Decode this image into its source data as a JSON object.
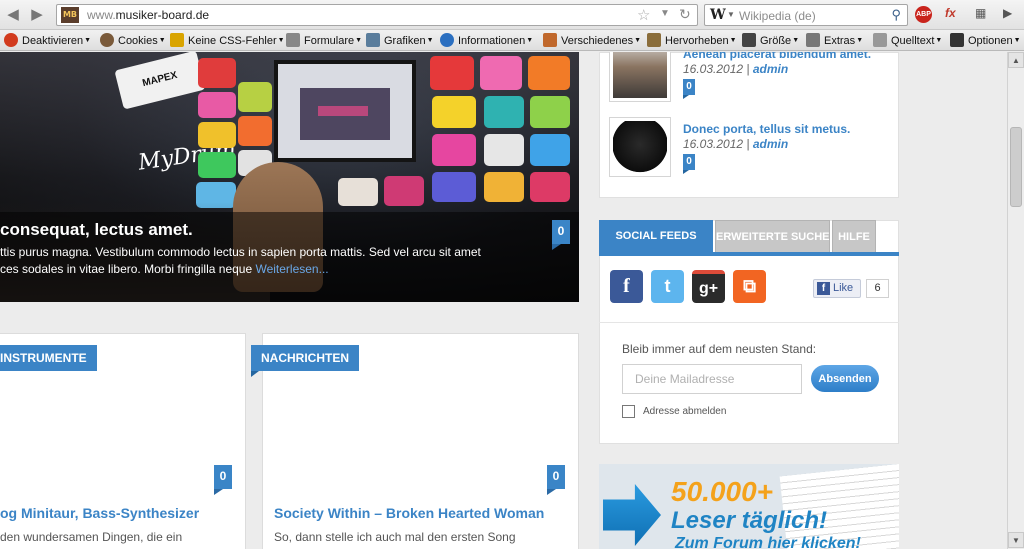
{
  "browser": {
    "url_prefix": "www.",
    "url_domain": "musiker-board.de",
    "site_icon_text": "MB",
    "search_placeholder": "Wikipedia (de)",
    "abp_label": "ABP"
  },
  "devtoolbar": {
    "items": [
      {
        "label": "Deaktivieren",
        "icon": "disable-icon",
        "color": "#d23b1e"
      },
      {
        "label": "Cookies",
        "icon": "cookies-icon",
        "color": "#7a5a3a"
      },
      {
        "label": "Keine CSS-Fehler",
        "icon": "css-pencil-icon",
        "color": "#d9a400"
      },
      {
        "label": "Formulare",
        "icon": "forms-icon",
        "color": "#555555"
      },
      {
        "label": "Grafiken",
        "icon": "images-icon",
        "color": "#5a7d9c"
      },
      {
        "label": "Informationen",
        "icon": "info-icon",
        "color": "#2b6fc0"
      },
      {
        "label": "Verschiedenes",
        "icon": "misc-icon",
        "color": "#c0682c"
      },
      {
        "label": "Hervorheben",
        "icon": "highlight-icon",
        "color": "#555555"
      },
      {
        "label": "Größe",
        "icon": "resize-icon",
        "color": "#444444"
      },
      {
        "label": "Extras",
        "icon": "tools-icon",
        "color": "#555555"
      },
      {
        "label": "Quelltext",
        "icon": "source-icon",
        "color": "#666666"
      },
      {
        "label": "Optionen",
        "icon": "options-icon",
        "color": "#333333"
      }
    ]
  },
  "slider": {
    "brand_sign": "MAPEX",
    "drum_sign": "MyDrum",
    "title": "consequat, lectus amet.",
    "text_line1": "ttis purus magna. Vestibulum commodo lectus in sapien porta mattis. Sed vel arcu sit amet",
    "text_line2": "ces sodales in vitae libero. Morbi fringilla neque ",
    "read_more": "Weiterlesen...",
    "comment_count": "0"
  },
  "cards": [
    {
      "category": "INSTRUMENTE",
      "count": "0",
      "title": "og Minitaur, Bass-Synthesizer",
      "text": "den wundersamen Dingen, die ein"
    },
    {
      "category": "NACHRICHTEN",
      "count": "0",
      "title": "Society Within – Broken Hearted Woman",
      "text": "So, dann stelle ich auch mal den ersten Song"
    }
  ],
  "sidebar_posts": [
    {
      "title": "Aenean placerat bibendum amet.",
      "date": "16.03.2012",
      "sep": " | ",
      "author": "admin",
      "count": "0"
    },
    {
      "title": "Donec porta, tellus sit metus.",
      "date": "16.03.2012",
      "sep": " | ",
      "author": "admin",
      "count": "0"
    }
  ],
  "widget": {
    "tabs": [
      "SOCIAL FEEDS",
      "ERWEITERTE SUCHE",
      "HILFE"
    ],
    "like_label": "Like",
    "like_count": "6",
    "newsletter_label": "Bleib immer auf dem neusten Stand:",
    "email_placeholder": "Deine Mailadresse",
    "submit_label": "Absenden",
    "unsubscribe_label": "Adresse abmelden"
  },
  "banner": {
    "big": "50.000+",
    "mid": "Leser täglich!",
    "small": "Zum Forum hier klicken!"
  },
  "colors": {
    "accent": "#3b84c6",
    "facebook": "#3b5998",
    "twitter": "#55acee",
    "gplus": "#dd4b39",
    "rss": "#f26522"
  }
}
